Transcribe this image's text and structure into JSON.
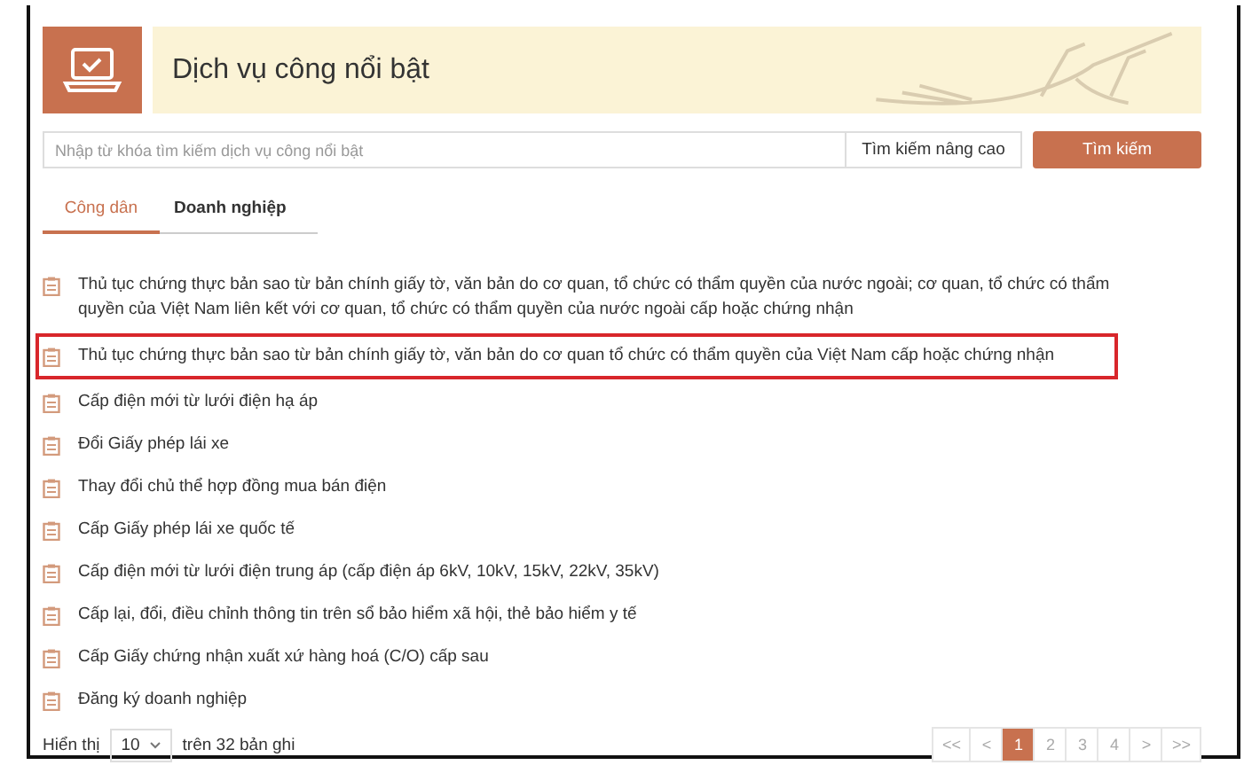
{
  "header": {
    "title": "Dịch vụ công nổi bật"
  },
  "search": {
    "placeholder": "Nhập từ khóa tìm kiếm dịch vụ công nổi bật",
    "advanced_label": "Tìm kiếm nâng cao",
    "button": "Tìm kiếm"
  },
  "tabs": [
    {
      "label": "Công dân",
      "selected": true
    },
    {
      "label": "Doanh nghiệp",
      "selected": false
    }
  ],
  "services": [
    {
      "text": "Thủ tục chứng thực bản sao từ bản chính giấy tờ, văn bản do cơ quan, tổ chức có thẩm quyền của nước ngoài; cơ quan, tổ chức có thẩm quyền của Việt Nam liên kết với cơ quan, tổ chức có thẩm quyền của nước ngoài cấp hoặc chứng nhận",
      "highlighted": false
    },
    {
      "text": "Thủ tục chứng thực bản sao từ bản chính giấy tờ, văn bản do cơ quan tổ chức có thẩm quyền của Việt Nam cấp hoặc chứng nhận",
      "highlighted": true
    },
    {
      "text": "Cấp điện mới từ lưới điện hạ áp",
      "highlighted": false
    },
    {
      "text": "Đổi Giấy phép lái xe",
      "highlighted": false
    },
    {
      "text": "Thay đổi chủ thể hợp đồng mua bán điện",
      "highlighted": false
    },
    {
      "text": "Cấp Giấy phép lái xe quốc tế",
      "highlighted": false
    },
    {
      "text": "Cấp điện mới từ lưới điện trung áp (cấp điện áp 6kV, 10kV, 15kV, 22kV, 35kV)",
      "highlighted": false
    },
    {
      "text": "Cấp lại, đổi, điều chỉnh thông tin trên sổ bảo hiểm xã hội, thẻ bảo hiểm y tế",
      "highlighted": false
    },
    {
      "text": "Cấp Giấy chứng nhận xuất xứ hàng hoá (C/O) cấp sau",
      "highlighted": false
    },
    {
      "text": "Đăng ký doanh nghiệp",
      "highlighted": false
    }
  ],
  "footer": {
    "show_label": "Hiển thị",
    "page_size": "10",
    "total_label": "trên 32 bản ghi"
  },
  "pagination": [
    {
      "label": "<<",
      "selected": false
    },
    {
      "label": "<",
      "selected": false
    },
    {
      "label": "1",
      "selected": true
    },
    {
      "label": "2",
      "selected": false
    },
    {
      "label": "3",
      "selected": false
    },
    {
      "label": "4",
      "selected": false
    },
    {
      "label": ">",
      "selected": false
    },
    {
      "label": ">>",
      "selected": false
    }
  ]
}
